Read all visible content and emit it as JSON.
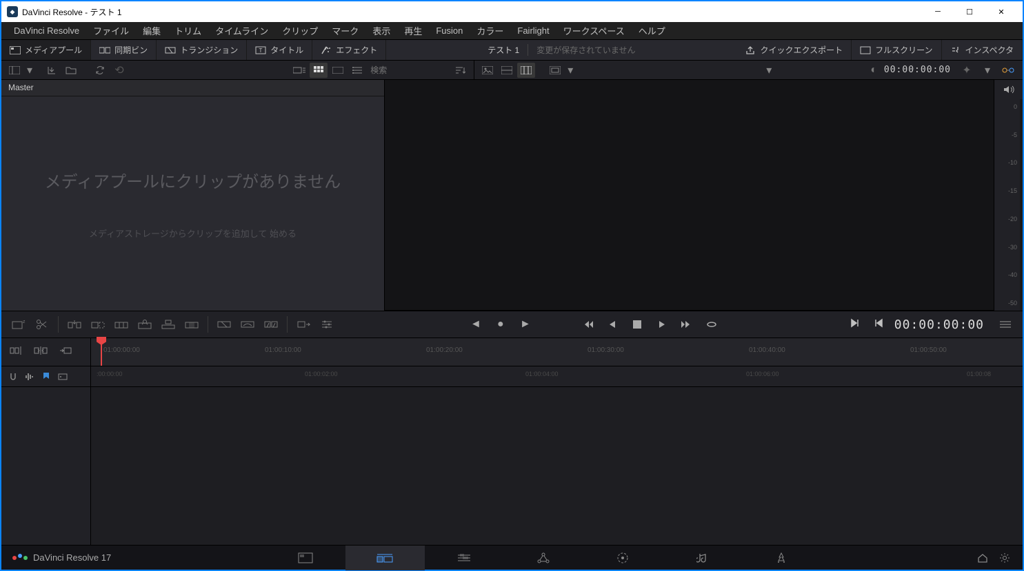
{
  "window": {
    "title": "DaVinci Resolve - テスト 1"
  },
  "menubar": [
    "DaVinci Resolve",
    "ファイル",
    "編集",
    "トリム",
    "タイムライン",
    "クリップ",
    "マーク",
    "表示",
    "再生",
    "Fusion",
    "カラー",
    "Fairlight",
    "ワークスペース",
    "ヘルプ"
  ],
  "toolbar_tabs": {
    "media_pool": "メディアプール",
    "sync_bin": "同期ビン",
    "transition": "トランジション",
    "title": "タイトル",
    "effect": "エフェクト",
    "project_name": "テスト 1",
    "unsaved_msg": "変更が保存されていません",
    "quick_export": "クイックエクスポート",
    "fullscreen": "フルスクリーン",
    "inspector": "インスペクタ"
  },
  "search": {
    "placeholder": "検索"
  },
  "master_label": "Master",
  "pool_empty": {
    "title": "メディアプールにクリップがありません",
    "subtitle": "メディアストレージからクリップを追加して 始める"
  },
  "timecode_preview": "00:00:00:00",
  "timecode_main": "00:00:00:00",
  "audio_scale": [
    "0",
    "-5",
    "-10",
    "-15",
    "-20",
    "-30",
    "-40",
    "-50"
  ],
  "ruler_top": [
    "01:00:00:00",
    "01:00:10:00",
    "01:00:20:00",
    "01:00:30:00",
    "01:00:40:00",
    "01:00:50:00"
  ],
  "ruler_bottom": [
    ":00:00:00",
    "01:00:02:00",
    "01:00:04:00",
    "01:00:06:00",
    "01:00:08"
  ],
  "bottom_brand": "DaVinci Resolve 17"
}
